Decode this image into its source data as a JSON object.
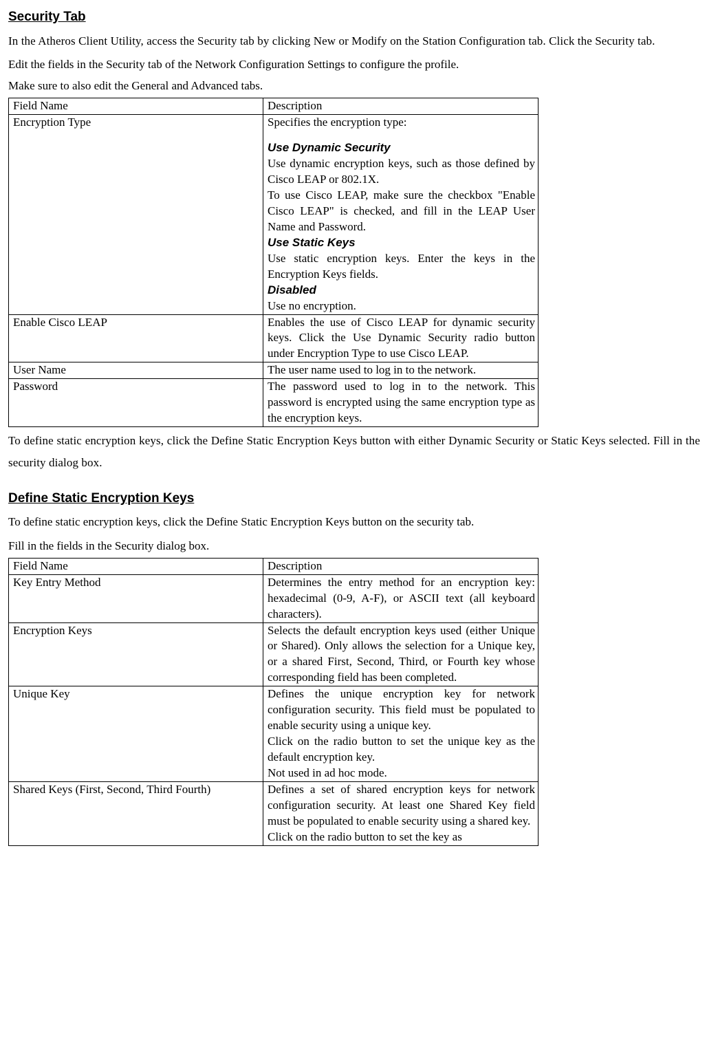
{
  "section1": {
    "heading": "Security Tab",
    "intro1": "In the Atheros Client Utility, access the Security tab by clicking New or Modify on the Station Configuration tab.   Click the Security tab.",
    "intro2": "Edit the fields in the Security   tab of the Network Configuration Settings to configure the profile.",
    "intro3": "Make sure to also edit the General and Advanced tabs.",
    "header_field": "Field Name",
    "header_desc": "Description",
    "row1": {
      "field": "Encryption Type",
      "desc_lead": "Specifies the encryption type:",
      "sub1_title": "Use Dynamic Security",
      "sub1_p1": "Use dynamic encryption keys, such as those defined by Cisco LEAP or 802.1X.",
      "sub1_p2": "To use Cisco LEAP, make sure the checkbox \"Enable Cisco LEAP\" is checked, and fill in the LEAP User Name and Password.",
      "sub2_title": "Use Static Keys",
      "sub2_p1": "Use static encryption keys. Enter the keys in the Encryption Keys fields.",
      "sub3_title": "Disabled",
      "sub3_p1": "Use no encryption."
    },
    "row2": {
      "field": "Enable Cisco LEAP",
      "desc": "Enables the use of Cisco LEAP for dynamic security keys.  Click the Use Dynamic Security radio button under Encryption Type to use Cisco LEAP."
    },
    "row3": {
      "field": "User Name",
      "desc": "The user name used to log in to the network."
    },
    "row4": {
      "field": "Password",
      "desc": "The password used to log in to the network.  This password is encrypted using the same encryption type as the encryption keys."
    },
    "outro": "To define static encryption keys, click the Define Static Encryption Keys button with either Dynamic Security or Static Keys selected.   Fill in the security dialog box."
  },
  "section2": {
    "heading": "Define Static Encryption Keys",
    "intro1": "To define static encryption keys, click the Define Static Encryption Keys button on the security tab.",
    "intro2": "Fill in the fields in the Security dialog box.",
    "header_field": "Field Name",
    "header_desc": "Description",
    "row1": {
      "field": "Key Entry Method",
      "desc": "Determines the entry method for an encryption key: hexadecimal (0-9, A-F), or ASCII text (all keyboard characters)."
    },
    "row2": {
      "field": "Encryption Keys",
      "desc": "Selects the default encryption keys used (either Unique or Shared). Only allows the selection for a Unique key, or a shared First, Second, Third, or Fourth key whose corresponding field has been completed."
    },
    "row3": {
      "field": "Unique Key",
      "desc_p1": "Defines the unique encryption key for network configuration security. This field must be populated to enable security using a unique key.",
      "desc_p2": "Click on the radio button to set the unique key as the default encryption key.",
      "desc_p3": "Not used in ad hoc mode."
    },
    "row4": {
      "field": "Shared Keys (First, Second, Third Fourth)",
      "desc_p1": "Defines a set of shared encryption keys for network configuration security. At least one Shared Key field must be populated to enable security using a shared key.",
      "desc_p2": "Click on the radio button to set the key as"
    }
  }
}
